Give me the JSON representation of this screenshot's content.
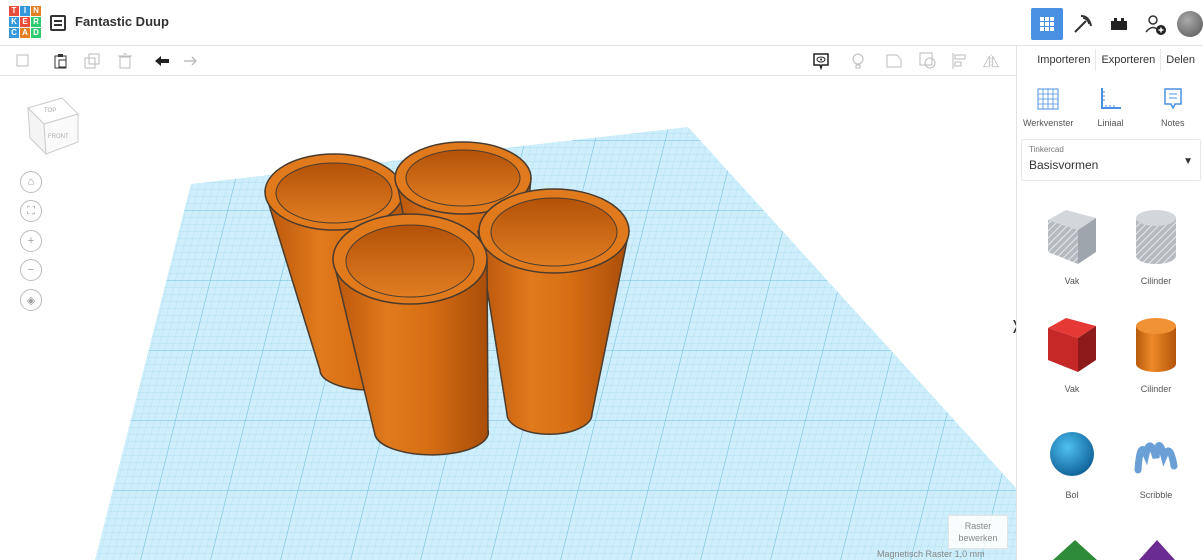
{
  "app": {
    "logo_letters": [
      "T",
      "I",
      "N",
      "K",
      "E",
      "R",
      "C",
      "A",
      "D"
    ],
    "logo_colors": [
      "#e74c3c",
      "#3498db",
      "#e67e22",
      "#3498db",
      "#e74c3c",
      "#2ecc71",
      "#3498db",
      "#e67e22",
      "#2ecc71"
    ],
    "title": "Fantastic Duup"
  },
  "header": {
    "views": [
      {
        "name": "3d-view",
        "active": true
      },
      {
        "name": "codeblocks",
        "active": false
      },
      {
        "name": "bricks",
        "active": false
      }
    ],
    "icons": [
      "grid-icon",
      "pickaxe-icon",
      "brick-icon",
      "add-user-icon",
      "avatar"
    ]
  },
  "toolbar": {
    "left_tools": [
      "copy-icon",
      "paste-icon",
      "duplicate-icon",
      "delete-icon",
      "undo-icon",
      "redo-icon"
    ],
    "right_tools": [
      "show-notes-icon",
      "light-icon",
      "shape-icon",
      "group-icon",
      "align-icon",
      "mirror-icon"
    ]
  },
  "right_panel": {
    "buttons": [
      "Importeren",
      "Exporteren",
      "Delen"
    ],
    "tools": [
      {
        "icon": "workplane-icon",
        "label": "Werkvenster"
      },
      {
        "icon": "ruler-icon",
        "label": "Liniaal"
      },
      {
        "icon": "notes-icon",
        "label": "Notes"
      }
    ],
    "library": {
      "source": "Tinkercad",
      "name": "Basisvormen"
    },
    "shapes": [
      {
        "label": "Vak",
        "color": "#9aa4ad"
      },
      {
        "label": "Cilinder",
        "color": "#b8bcc1"
      },
      {
        "label": "Vak",
        "color": "#d32f2f"
      },
      {
        "label": "Cilinder",
        "color": "#e67e22"
      },
      {
        "label": "Bol",
        "color": "#1e88c9"
      },
      {
        "label": "Scribble",
        "color": "#6aa0d6"
      }
    ]
  },
  "viewcube": {
    "top": "TOP",
    "front": "FRONT"
  },
  "workplane": {
    "raster_label_1": "Raster",
    "raster_label_2": "bewerken",
    "snap_label": "Magnetisch Raster",
    "snap_value": "1,0 mm"
  },
  "colors": {
    "accent": "#4a90e2",
    "grid": "#8dd0ee",
    "object": "#dd7014"
  }
}
